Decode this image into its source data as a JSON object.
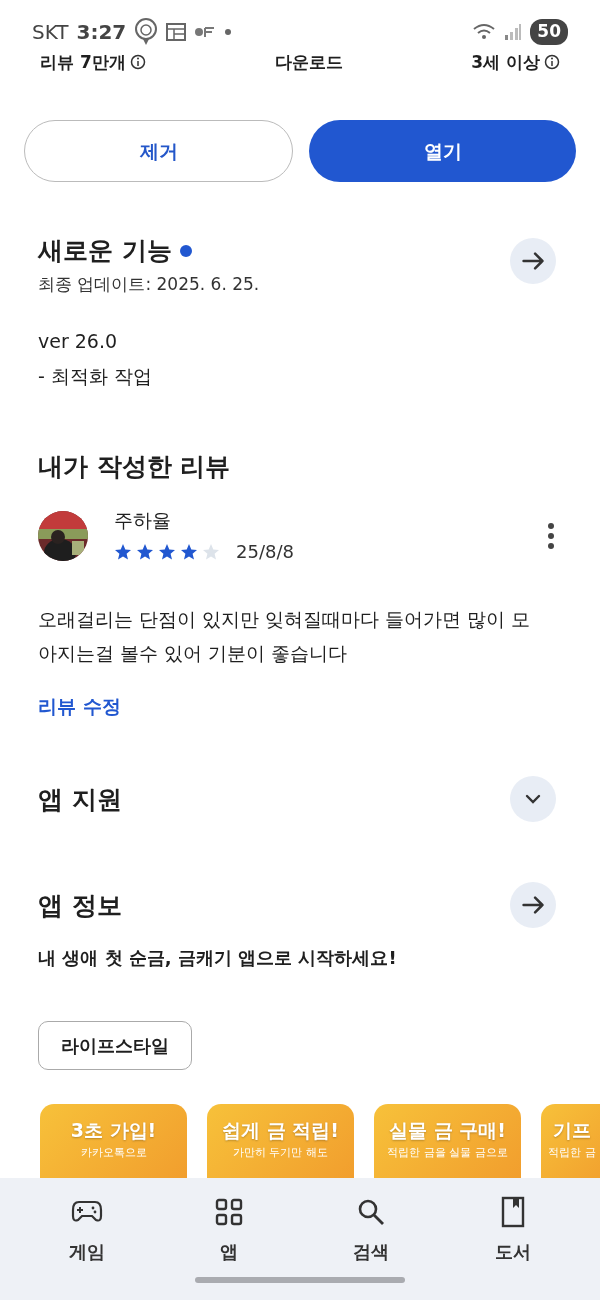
{
  "status_bar": {
    "carrier": "SKT",
    "time": "3:27",
    "battery": "50"
  },
  "stats": [
    {
      "label": "리뷰 7만개",
      "info": true
    },
    {
      "label": "다운로드",
      "info": false
    },
    {
      "label": "3세 이상",
      "info": true
    }
  ],
  "buttons": [
    {
      "label": "제거",
      "kind": "outline"
    },
    {
      "label": "열기",
      "kind": "primary"
    }
  ],
  "whats_new": {
    "title": "새로운 기능",
    "new_dot": true,
    "updated": "최종 업데이트: 2025. 6. 25.",
    "version": "ver 26.0",
    "notes": "- 최적화 작업"
  },
  "my_review": {
    "title": "내가 작성한 리뷰",
    "author": "주하율",
    "stars": 4,
    "date": "25/8/8",
    "text": "오래걸리는 단점이 있지만 잊혀질때마다 들어가면 많이 모아지는걸 볼수 있어 기분이 좋습니다",
    "edit_link": "리뷰 수정"
  },
  "sections": [
    {
      "title": "앱 지원",
      "kind": "expand"
    },
    {
      "title": "앱 정보",
      "kind": "arrow",
      "description": "내 생애 첫 순금, 금캐기 앱으로 시작하세요!"
    }
  ],
  "category_chip": "라이프스타일",
  "screenshots": [
    {
      "headline": "3초 가입!",
      "subline": "카카오톡으로"
    },
    {
      "headline": "쉽게 금 적립!",
      "subline": "가만히 두기만 해도"
    },
    {
      "headline": "실물 금 구매!",
      "subline": "적립한 금을 실물 금으로"
    },
    {
      "headline": "기프",
      "subline": "적립한 금"
    }
  ],
  "bottom_nav": [
    {
      "label": "게임"
    },
    {
      "label": "앱"
    },
    {
      "label": "검색"
    },
    {
      "label": "도서"
    }
  ]
}
